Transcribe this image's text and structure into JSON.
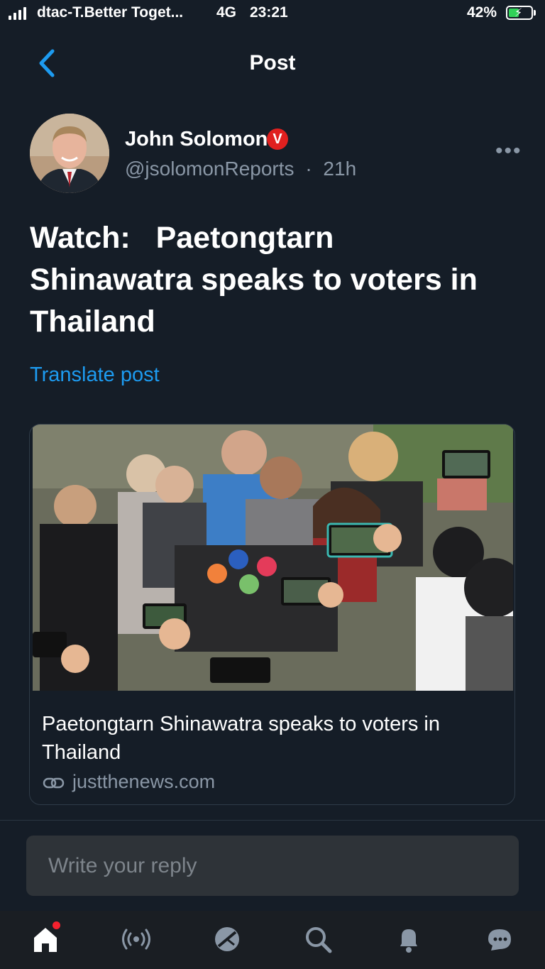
{
  "status_bar": {
    "carrier": "dtac-T.Better Toget...",
    "network": "4G",
    "time": "23:21",
    "battery": "42%"
  },
  "header": {
    "title": "Post"
  },
  "author": {
    "name": "John Solomon",
    "verified_badge": "V",
    "handle": "@jsolomonReports",
    "separator": "·",
    "time_ago": "21h",
    "more": "•••"
  },
  "post": {
    "text": "Watch:   Paetongtarn\nShinawatra speaks to voters in\nThailand",
    "translate_label": "Translate post"
  },
  "link_card": {
    "title": "Paetongtarn Shinawatra speaks to voters in Thailand",
    "domain": "justthenews.com"
  },
  "reply": {
    "placeholder": "Write your reply"
  },
  "tabbar": {
    "items": [
      "home-icon",
      "spaces-icon",
      "grok-icon",
      "search-icon",
      "notifications-icon",
      "messages-icon"
    ],
    "home_has_badge": true
  },
  "colors": {
    "background": "#151d27",
    "accent": "#1d9bf0",
    "verified": "#e0201f",
    "muted_text": "#8a97a6"
  }
}
